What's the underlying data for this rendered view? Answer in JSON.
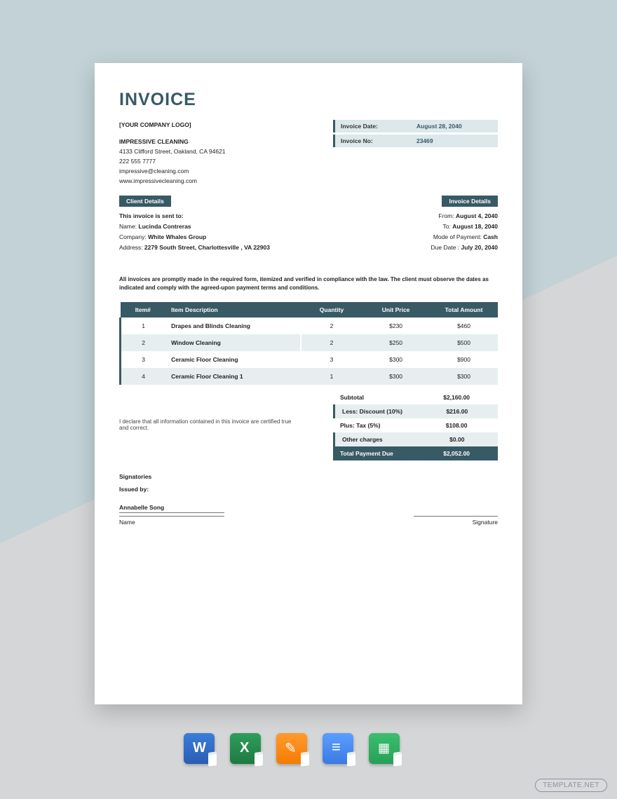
{
  "title": "INVOICE",
  "company": {
    "logo": "[YOUR COMPANY LOGO]",
    "name": "IMPRESSIVE CLEANING",
    "address": "4133 Clifford Street, Oakland, CA 94621",
    "phone": "222 555 7777",
    "email": "impressive@cleaning.com",
    "web": "www.impressivecleaning.com"
  },
  "meta": {
    "date_label": "Invoice Date:",
    "date_value": "August 28, 2040",
    "no_label": "Invoice No:",
    "no_value": "23469"
  },
  "section": {
    "client": "Client Details",
    "invoice": "Invoice Details"
  },
  "client": {
    "sent_label": "This invoice is sent to:",
    "name_label": "Name:",
    "name": "Lucinda Contreras",
    "company_label": "Company:",
    "company": "White Whales Group",
    "address_label": "Address:",
    "address": "2279 South Street, Charlottesville , VA 22903"
  },
  "inv": {
    "from_label": "From:",
    "from": "August 4, 2040",
    "to_label": "To:",
    "to": "August 18, 2040",
    "mode_label": "Mode of Payment:",
    "mode": "Cash",
    "due_label": "Due Date :",
    "due": "July 20, 2040"
  },
  "note": "All invoices are promptly made in the required form, itemized and verified in compliance with the law. The client must observe the dates as indicated and comply with the agreed-upon payment terms and conditions.",
  "cols": {
    "item": "Item#",
    "desc": "Item Description",
    "qty": "Quantity",
    "price": "Unit Price",
    "total": "Total Amount"
  },
  "rows": [
    {
      "n": "1",
      "d": "Drapes and Blinds Cleaning",
      "q": "2",
      "p": "$230",
      "t": "$460"
    },
    {
      "n": "2",
      "d": "Window Cleaning",
      "q": "2",
      "p": "$250",
      "t": "$500"
    },
    {
      "n": "3",
      "d": "Ceramic Floor Cleaning",
      "q": "3",
      "p": "$300",
      "t": "$900"
    },
    {
      "n": "4",
      "d": "Ceramic Floor Cleaning 1",
      "q": "1",
      "p": "$300",
      "t": "$300"
    }
  ],
  "totals": {
    "subtotal_l": "Subtotal",
    "subtotal_v": "$2,160.00",
    "discount_l": "Less: Discount (10%)",
    "discount_v": "$216.00",
    "tax_l": "Plus: Tax (5%)",
    "tax_v": "$108.00",
    "other_l": "Other charges",
    "other_v": "$0.00",
    "due_l": "Total Payment Due",
    "due_v": "$2,052.00"
  },
  "decl": "I declare that all information contained in this invoice are certified true and correct.",
  "sig": {
    "head": "Signatories",
    "by": "Issued by:",
    "name": "Annabelle Song",
    "name_l": "Name",
    "sig_l": "Signature"
  },
  "watermark": "TEMPLATE.NET"
}
